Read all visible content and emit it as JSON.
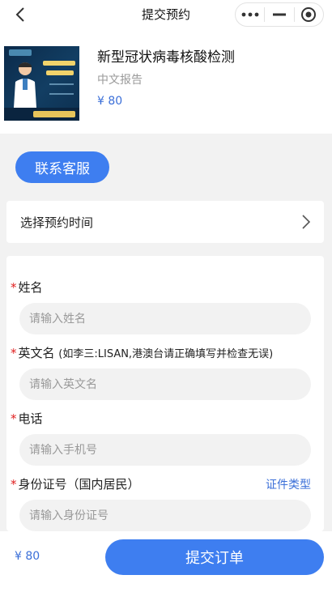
{
  "nav": {
    "title": "提交预约",
    "back_icon": "chevron-left-icon",
    "more_icon": "more-dots-icon",
    "minimize_icon": "minimize-icon",
    "close_icon": "target-circle-icon"
  },
  "product": {
    "title": "新型冠状病毒核酸检测",
    "subtitle": "中文报告",
    "price": "¥ 80"
  },
  "customer_service": {
    "label": "联系客服"
  },
  "appointment": {
    "label": "选择预约时间",
    "arrow_icon": "chevron-right-icon"
  },
  "form": {
    "name": {
      "label": "姓名",
      "placeholder": "请输入姓名"
    },
    "english_name": {
      "label": "英文名",
      "hint": "(如李三:LISAN,港澳台请正确填写并检查无误)",
      "placeholder": "请输入英文名"
    },
    "phone": {
      "label": "电话",
      "placeholder": "请输入手机号"
    },
    "id_number": {
      "label": "身份证号（国内居民）",
      "placeholder": "请输入身份证号",
      "type_link": "证件类型"
    }
  },
  "footer": {
    "price": "¥ 80",
    "submit_label": "提交订单"
  },
  "colors": {
    "accent": "#3e7ef0",
    "price": "#3b6fd8",
    "required": "#e02020",
    "background": "#f2f2f2"
  }
}
